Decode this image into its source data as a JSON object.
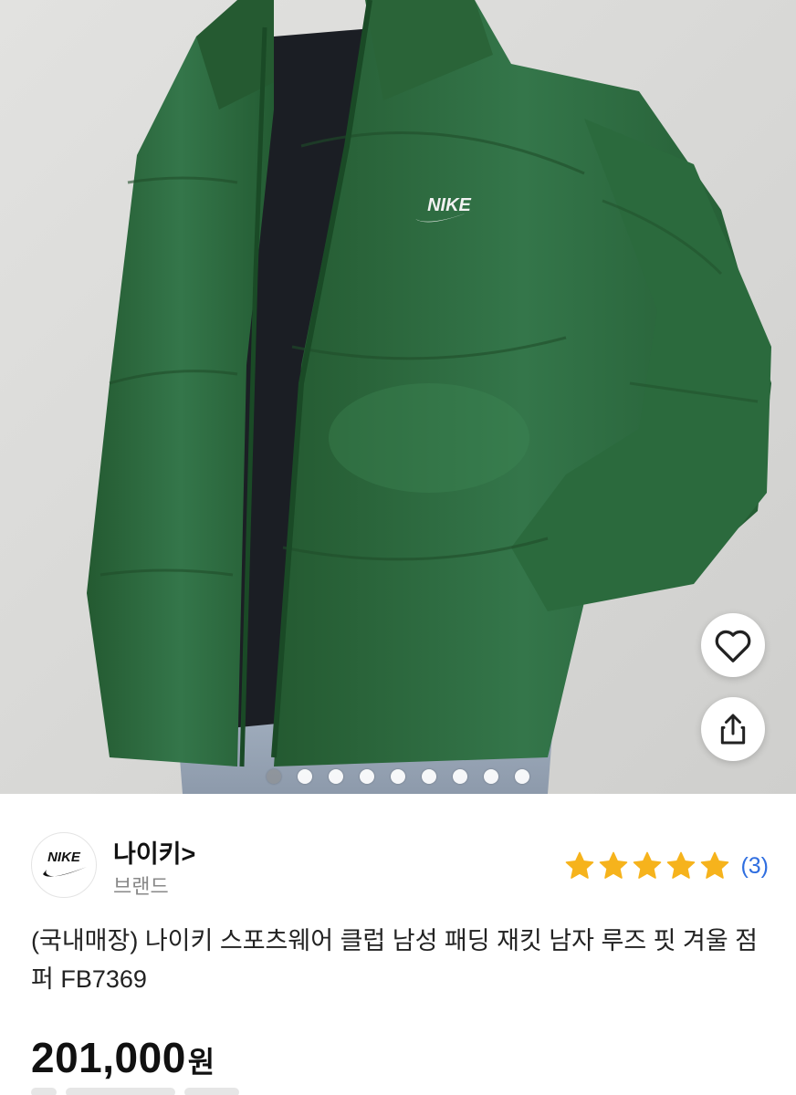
{
  "product_image": {
    "description_icon": "jacket-photo",
    "dots": {
      "count": 9,
      "active_index": 0
    },
    "actions": [
      {
        "name": "like",
        "icon": "heart-icon"
      },
      {
        "name": "share",
        "icon": "share-icon"
      }
    ]
  },
  "seller": {
    "name": "나이키>",
    "type": "브랜드",
    "logo_text": "NIKE",
    "rating_stars": 5,
    "rating_count": "(3)"
  },
  "product": {
    "title": "(국내매장) 나이키 스포츠웨어 클럽 남성 패딩 재킷 남자 루즈 핏 겨울 점퍼 FB7369",
    "price": "201,000",
    "price_unit": "원"
  },
  "colors": {
    "star": "#f6b31c",
    "rating_link": "#2f6ee0",
    "jacket": "#2f6b3e"
  }
}
